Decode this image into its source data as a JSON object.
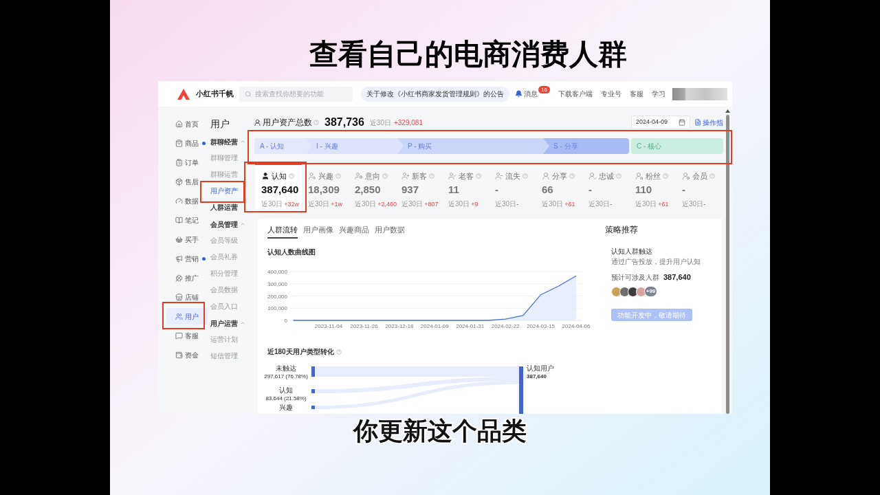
{
  "slide": {
    "title": "查看自己的电商消费人群",
    "caption": "你更新这个品类"
  },
  "topbar": {
    "brand": "小红书千帆",
    "search": {
      "placeholder": "搜索查找你想要的功能"
    },
    "notice": "关于修改《小红书商家发货管理规则》的公告",
    "messages": {
      "label": "消息",
      "badge": "16"
    },
    "links": [
      "下载客户端",
      "专业号",
      "客服",
      "学习"
    ]
  },
  "sidebar": {
    "items": [
      {
        "label": "首页",
        "selected": false,
        "dot": false,
        "highlighted": false
      },
      {
        "label": "商品",
        "selected": false,
        "dot": true,
        "highlighted": false
      },
      {
        "label": "订单",
        "selected": false,
        "dot": false,
        "highlighted": false
      },
      {
        "label": "售后",
        "selected": false,
        "dot": false,
        "highlighted": false
      },
      {
        "label": "数据",
        "selected": false,
        "dot": false,
        "highlighted": false
      },
      {
        "label": "笔记",
        "selected": false,
        "dot": false,
        "highlighted": false
      },
      {
        "label": "买手",
        "selected": false,
        "dot": false,
        "highlighted": false
      },
      {
        "label": "营销",
        "selected": false,
        "dot": true,
        "highlighted": false
      },
      {
        "label": "推广",
        "selected": false,
        "dot": false,
        "highlighted": false
      },
      {
        "label": "店铺",
        "selected": false,
        "dot": false,
        "highlighted": false
      },
      {
        "label": "用户",
        "selected": true,
        "dot": false,
        "highlighted": true
      },
      {
        "label": "客服",
        "selected": false,
        "dot": false,
        "highlighted": false
      },
      {
        "label": "资金",
        "selected": false,
        "dot": false,
        "highlighted": false
      }
    ]
  },
  "subnav": {
    "title": "用户",
    "groups": [
      {
        "kind": "group",
        "label": "群聊经营",
        "expanded": true,
        "children": [
          {
            "label": "群聊管理",
            "selected": false,
            "highlighted": false
          },
          {
            "label": "群聊运营",
            "selected": false,
            "highlighted": false
          },
          {
            "label": "用户资产",
            "selected": true,
            "highlighted": true
          }
        ]
      },
      {
        "kind": "link",
        "label": "人群运营",
        "selected": false,
        "highlighted": false
      },
      {
        "kind": "group",
        "label": "会员管理",
        "expanded": true,
        "children": [
          {
            "label": "会员等级",
            "selected": false,
            "highlighted": false
          },
          {
            "label": "会员礼券",
            "selected": false,
            "highlighted": false
          },
          {
            "label": "积分管理",
            "selected": false,
            "highlighted": false
          },
          {
            "label": "会员数据",
            "selected": false,
            "highlighted": false
          },
          {
            "label": "会员入口",
            "selected": false,
            "highlighted": false
          }
        ]
      },
      {
        "kind": "group",
        "label": "用户运营",
        "expanded": true,
        "children": [
          {
            "label": "运营计划",
            "selected": false,
            "highlighted": false
          },
          {
            "label": "短信管理",
            "selected": false,
            "highlighted": false
          }
        ]
      }
    ]
  },
  "assets": {
    "label": "用户资产总数",
    "total": "387,736",
    "period": "近30日",
    "change": "+329,081",
    "date": {
      "value": "2024-04-09"
    },
    "guide": "操作指"
  },
  "funnel": {
    "highlighted": true,
    "stages": [
      {
        "kind": "step",
        "label": "A - 认知",
        "color": "#e3e8fa"
      },
      {
        "kind": "step",
        "label": "I - 兴趣",
        "color": "#dce3fb"
      },
      {
        "kind": "step",
        "label": "P - 购买",
        "color": "#cbd6fb"
      },
      {
        "kind": "step",
        "label": "S - 分享",
        "color": "#a9bbf5"
      },
      {
        "kind": "core",
        "label": "C - 核心",
        "color": "#cbeee0"
      }
    ]
  },
  "metrics": [
    {
      "label": "认知",
      "value": "387,640",
      "period": "近30日",
      "change": "+32w",
      "increase": true,
      "selected": true,
      "highlighted": true
    },
    {
      "label": "兴趣",
      "value": "18,309",
      "period": "近30日",
      "change": "+1w",
      "increase": true,
      "selected": false,
      "highlighted": false
    },
    {
      "label": "意向",
      "value": "2,850",
      "period": "近30日",
      "change": "+2,460",
      "increase": true,
      "selected": false,
      "highlighted": false
    },
    {
      "label": "新客",
      "value": "937",
      "period": "近30日",
      "change": "+807",
      "increase": true,
      "selected": false,
      "highlighted": false
    },
    {
      "label": "老客",
      "value": "11",
      "period": "近30日",
      "change": "+9",
      "increase": true,
      "selected": false,
      "highlighted": false
    },
    {
      "label": "流失",
      "value": "-",
      "period": "近30日",
      "change": "-",
      "increase": false,
      "selected": false,
      "highlighted": false
    },
    {
      "label": "分享",
      "value": "66",
      "period": "近30日",
      "change": "+61",
      "increase": true,
      "selected": false,
      "highlighted": false
    },
    {
      "label": "忠诚",
      "value": "-",
      "period": "近30日",
      "change": "-",
      "increase": false,
      "selected": false,
      "highlighted": false
    },
    {
      "label": "粉丝",
      "value": "110",
      "period": "近30日",
      "change": "+61",
      "increase": true,
      "selected": false,
      "highlighted": false
    },
    {
      "label": "会员",
      "value": "-",
      "period": "近30日",
      "change": "-",
      "increase": false,
      "selected": false,
      "highlighted": false
    }
  ],
  "tabs": [
    {
      "label": "人群流转",
      "selected": true
    },
    {
      "label": "用户画像",
      "selected": false
    },
    {
      "label": "兴趣商品",
      "selected": false
    },
    {
      "label": "用户数据",
      "selected": false
    }
  ],
  "curve": {
    "chart_data": {
      "type": "area",
      "title": "认知人数曲线图",
      "categories": [
        null,
        null,
        "2023-11-04",
        null,
        "2023-11-26",
        null,
        "2023-12-18",
        null,
        "2024-01-09",
        null,
        "2024-01-31",
        null,
        "2024-02-22",
        null,
        "2024-03-15",
        null,
        "2024-04-06"
      ],
      "values": [
        0,
        0,
        0,
        0,
        0,
        0,
        0,
        0,
        0,
        0,
        0,
        0,
        10000,
        40000,
        210000,
        280000,
        365000
      ],
      "yticks": [
        {
          "value": 0,
          "label": "0"
        },
        {
          "value": 100000,
          "label": "100,000"
        },
        {
          "value": 200000,
          "label": "200,000"
        },
        {
          "value": 300000,
          "label": "300,000"
        },
        {
          "value": 400000,
          "label": "400,000"
        }
      ],
      "ylim": [
        0,
        400000
      ],
      "grid": true
    }
  },
  "strategy": {
    "title": "策略推荐",
    "card": {
      "name": "认知人群触达",
      "description": "通过广告投放，提升用户认知",
      "reach_label": "预计可涉及人群",
      "reach": "387,640",
      "avatars_more": "+99",
      "button": {
        "label": "功能开发中，敬请期待",
        "disabled": true
      }
    }
  },
  "conversion": {
    "title": "近180天用户类型转化",
    "sources": [
      {
        "name": "未触达",
        "value": "297,617 (76.78%)"
      },
      {
        "name": "认知",
        "value": "83,644 (21.58%)"
      },
      {
        "name": "兴趣"
      }
    ],
    "target": {
      "name": "认知用户",
      "value": "387,640"
    }
  }
}
